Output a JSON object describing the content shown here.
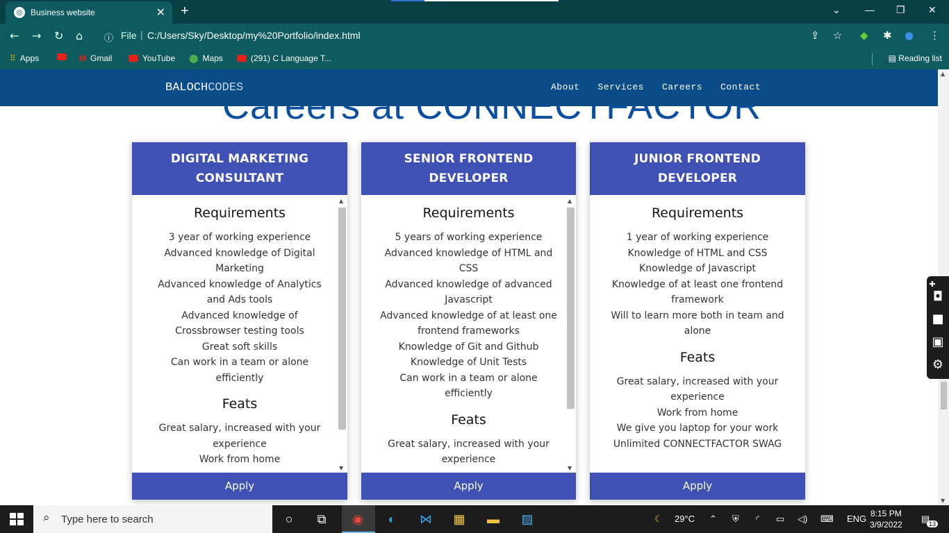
{
  "browser": {
    "tab_title": "Business website",
    "tab_favicon": "globe-icon",
    "address_file_label": "File",
    "address_url": "C:/Users/Sky/Desktop/my%20Portfolio/index.html",
    "bookmarks": [
      {
        "label": "Apps",
        "icon": "apps-grid-icon"
      },
      {
        "label": "",
        "icon": "youtube-icon"
      },
      {
        "label": "Gmail",
        "icon": "gmail-icon"
      },
      {
        "label": "YouTube",
        "icon": "youtube-icon"
      },
      {
        "label": "Maps",
        "icon": "maps-icon"
      },
      {
        "label": "(291) C Language T...",
        "icon": "youtube-icon"
      }
    ],
    "reading_list": "Reading list",
    "page_load_progress": 0.2
  },
  "site": {
    "brand_part1": "BALOCH",
    "brand_part2": "CODES",
    "menu": [
      "About",
      "Services",
      "Careers",
      "Contact"
    ],
    "background_heading": "Careers at CONNECTFACTOR"
  },
  "cards": [
    {
      "title_line1": "DIGITAL MARKETING",
      "title_line2": "CONSULTANT",
      "req_heading": "Requirements",
      "requirements": [
        "3 year of working experience",
        "Advanced knowledge of Digital Marketing",
        "Advanced knowledge of Analytics and Ads tools",
        "Advanced knowledge of Crossbrowser testing tools",
        "Great soft skills",
        "Can work in a team or alone efficiently"
      ],
      "feats_heading": "Feats",
      "feats": [
        "Great salary, increased with your experience",
        "Work from home"
      ],
      "apply": "Apply"
    },
    {
      "title_line1": "SENIOR FRONTEND",
      "title_line2": "DEVELOPER",
      "req_heading": "Requirements",
      "requirements": [
        "5 years of working experience",
        "Advanced knowledge of HTML and CSS",
        "Advanced knowledge of advanced Javascript",
        "Advanced knowledge of at least one frontend frameworks",
        "Knowledge of Git and Github",
        "Knowledge of Unit Tests",
        "Can work in a team or alone efficiently"
      ],
      "feats_heading": "Feats",
      "feats": [
        "Great salary, increased with your experience"
      ],
      "apply": "Apply"
    },
    {
      "title_line1": "JUNIOR FRONTEND",
      "title_line2": "DEVELOPER",
      "req_heading": "Requirements",
      "requirements": [
        "1 year of working experience",
        "Knowledge of HTML and CSS",
        "Knowledge of Javascript",
        "Knowledge of at least one frontend framework",
        "Will to learn more both in team and alone"
      ],
      "feats_heading": "Feats",
      "feats": [
        "Great salary, increased with your experience",
        "Work from home",
        "We give you laptop for your work",
        "Unlimited CONNECTFACTOR SWAG"
      ],
      "apply": "Apply"
    }
  ],
  "taskbar": {
    "search_placeholder": "Type here to search",
    "weather": "29°C",
    "language": "ENG",
    "time": "8:15 PM",
    "date": "3/9/2022",
    "notifications": "13"
  }
}
